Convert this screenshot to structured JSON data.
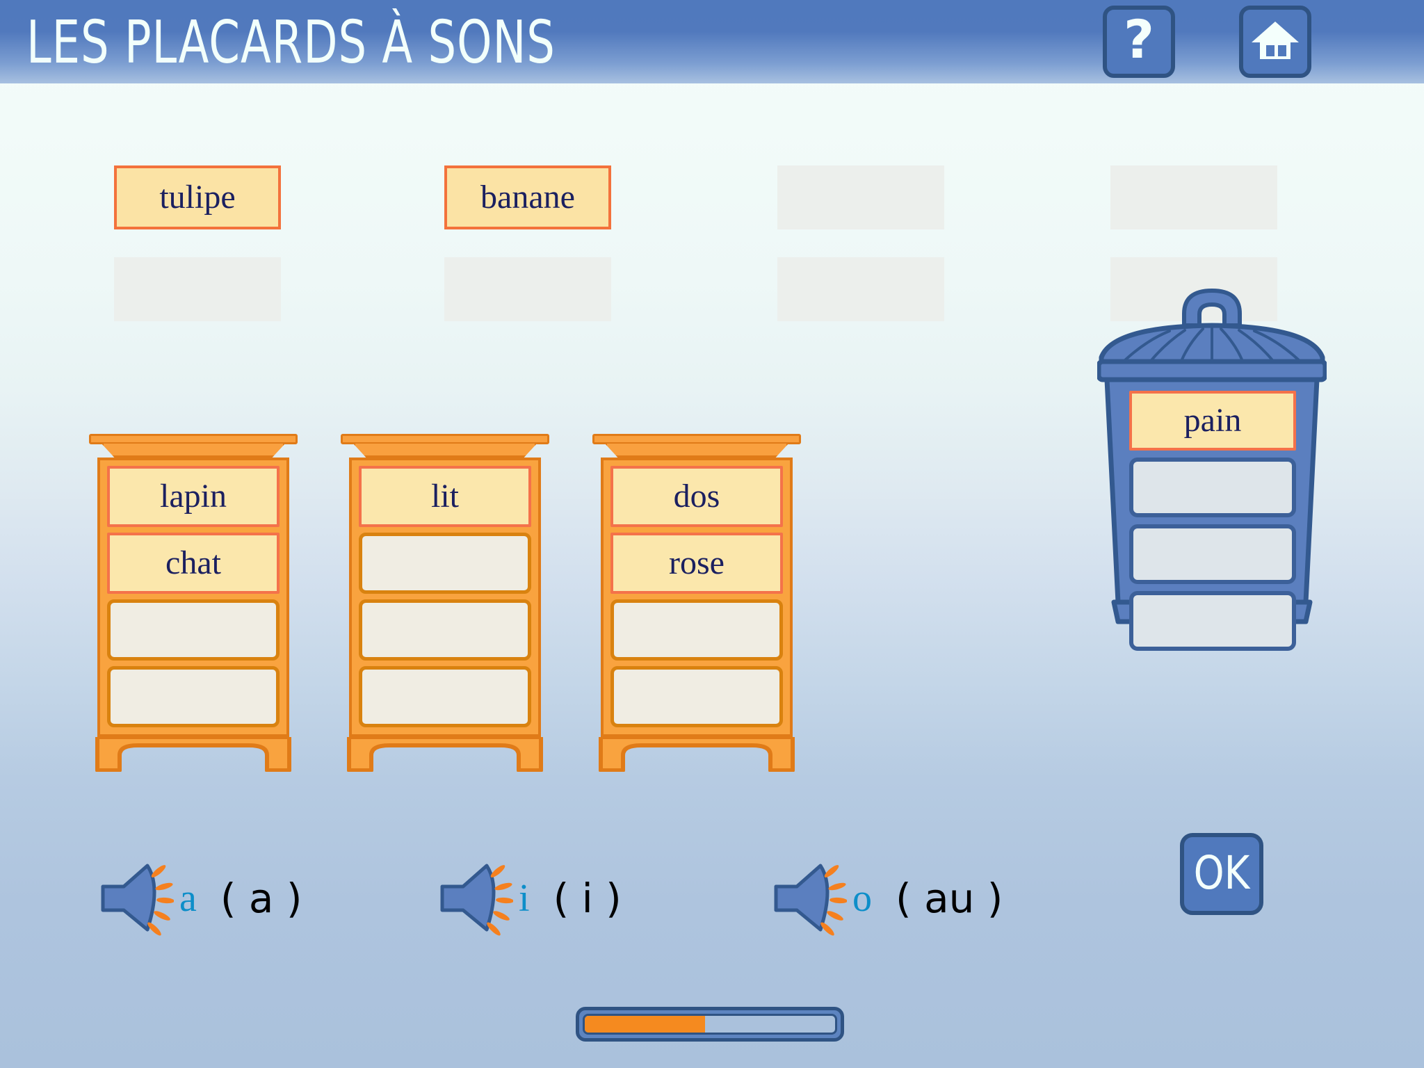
{
  "header": {
    "title": "LES PLACARDS À SONS",
    "help_label": "?",
    "help_icon": "question-mark-icon",
    "home_icon": "home-icon"
  },
  "word_bank": {
    "columns": [
      {
        "slots": [
          {
            "word": "tulipe",
            "filled": true
          },
          {
            "word": "",
            "filled": false
          }
        ]
      },
      {
        "slots": [
          {
            "word": "banane",
            "filled": true
          },
          {
            "word": "",
            "filled": false
          }
        ]
      },
      {
        "slots": [
          {
            "word": "",
            "filled": false
          },
          {
            "word": "",
            "filled": false
          }
        ]
      },
      {
        "slots": [
          {
            "word": "",
            "filled": false
          },
          {
            "word": "",
            "filled": false
          }
        ]
      }
    ],
    "tulipe": "tulipe",
    "banane": "banane"
  },
  "cabinets": [
    {
      "name": "cabinet-a",
      "drawers": [
        {
          "word": "lapin",
          "filled": true
        },
        {
          "word": "chat",
          "filled": true
        },
        {
          "word": "",
          "filled": false
        },
        {
          "word": "",
          "filled": false
        }
      ]
    },
    {
      "name": "cabinet-i",
      "drawers": [
        {
          "word": "lit",
          "filled": true
        },
        {
          "word": "",
          "filled": false
        },
        {
          "word": "",
          "filled": false
        },
        {
          "word": "",
          "filled": false
        }
      ]
    },
    {
      "name": "cabinet-o",
      "drawers": [
        {
          "word": "dos",
          "filled": true
        },
        {
          "word": "rose",
          "filled": true
        },
        {
          "word": "",
          "filled": false
        },
        {
          "word": "",
          "filled": false
        }
      ]
    }
  ],
  "bin": {
    "name": "trash-bin",
    "icon": "trash-bin-icon",
    "slots": [
      {
        "word": "pain",
        "filled": true
      },
      {
        "word": "",
        "filled": false
      },
      {
        "word": "",
        "filled": false
      },
      {
        "word": "",
        "filled": false
      }
    ]
  },
  "sounds": [
    {
      "icon": "speaker-icon",
      "phoneme": "a",
      "grapheme": "( a )"
    },
    {
      "icon": "speaker-icon",
      "phoneme": "i",
      "grapheme": "( i )"
    },
    {
      "icon": "speaker-icon",
      "phoneme": "o",
      "grapheme": "( au )"
    }
  ],
  "ok_button": {
    "label": "OK"
  },
  "progress": {
    "percent": 48,
    "fill_width": "48%"
  },
  "colors": {
    "header_blue": "#5079bd",
    "header_blue_dark": "#2f5383",
    "cabinet_orange": "#f9a33f",
    "cabinet_orange_dark": "#e07b18",
    "card_yellow": "#fbe7ac",
    "card_border": "#f4724a",
    "empty_slot": "#ecefec",
    "word_navy": "#1b2060",
    "phoneme_cyan": "#0d8ec9",
    "progress_orange": "#f58a1f",
    "bin_blue": "#5b7fbf"
  }
}
